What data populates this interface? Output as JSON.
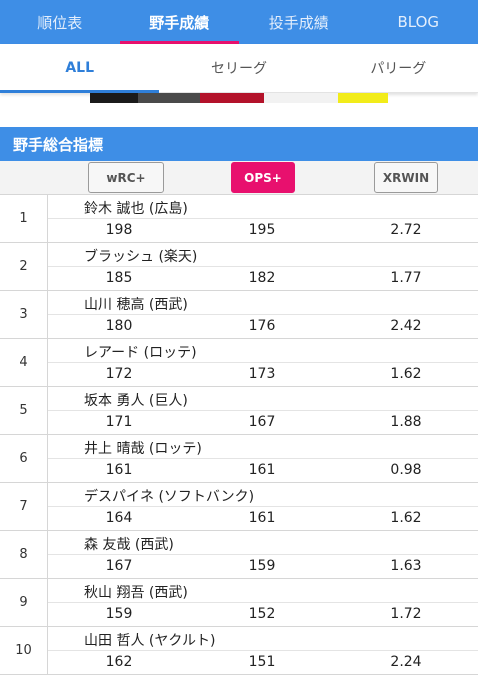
{
  "nav": {
    "tabs": [
      {
        "label": "順位表"
      },
      {
        "label": "野手成績"
      },
      {
        "label": "投手成績"
      },
      {
        "label": "BLOG"
      }
    ],
    "active": 1
  },
  "league_tabs": {
    "tabs": [
      {
        "label": "ALL"
      },
      {
        "label": "セリーグ"
      },
      {
        "label": "パリーグ"
      }
    ],
    "active": 0
  },
  "section": {
    "title": "野手総合指標"
  },
  "sort_buttons": [
    {
      "label": "wRC+"
    },
    {
      "label": "OPS+"
    },
    {
      "label": "XRWIN"
    }
  ],
  "active_sort": "OPS+",
  "players": [
    {
      "rank": "1",
      "name": "鈴木 誠也 (広島)",
      "wrc": "198",
      "ops": "195",
      "xrwin": "2.72"
    },
    {
      "rank": "2",
      "name": "ブラッシュ (楽天)",
      "wrc": "185",
      "ops": "182",
      "xrwin": "1.77"
    },
    {
      "rank": "3",
      "name": "山川 穂高 (西武)",
      "wrc": "180",
      "ops": "176",
      "xrwin": "2.42"
    },
    {
      "rank": "4",
      "name": "レアード (ロッテ)",
      "wrc": "172",
      "ops": "173",
      "xrwin": "1.62"
    },
    {
      "rank": "5",
      "name": "坂本 勇人 (巨人)",
      "wrc": "171",
      "ops": "167",
      "xrwin": "1.88"
    },
    {
      "rank": "6",
      "name": "井上 晴哉 (ロッテ)",
      "wrc": "161",
      "ops": "161",
      "xrwin": "0.98"
    },
    {
      "rank": "7",
      "name": "デスパイネ (ソフトバンク)",
      "wrc": "164",
      "ops": "161",
      "xrwin": "1.62"
    },
    {
      "rank": "8",
      "name": "森 友哉 (西武)",
      "wrc": "167",
      "ops": "159",
      "xrwin": "1.63"
    },
    {
      "rank": "9",
      "name": "秋山 翔吾 (西武)",
      "wrc": "159",
      "ops": "152",
      "xrwin": "1.72"
    },
    {
      "rank": "10",
      "name": "山田 哲人 (ヤクルト)",
      "wrc": "162",
      "ops": "151",
      "xrwin": "2.24"
    }
  ],
  "colors": {
    "primary": "#3e8ee6",
    "accent": "#e8106e",
    "active_subtab": "#2f7fd9"
  }
}
